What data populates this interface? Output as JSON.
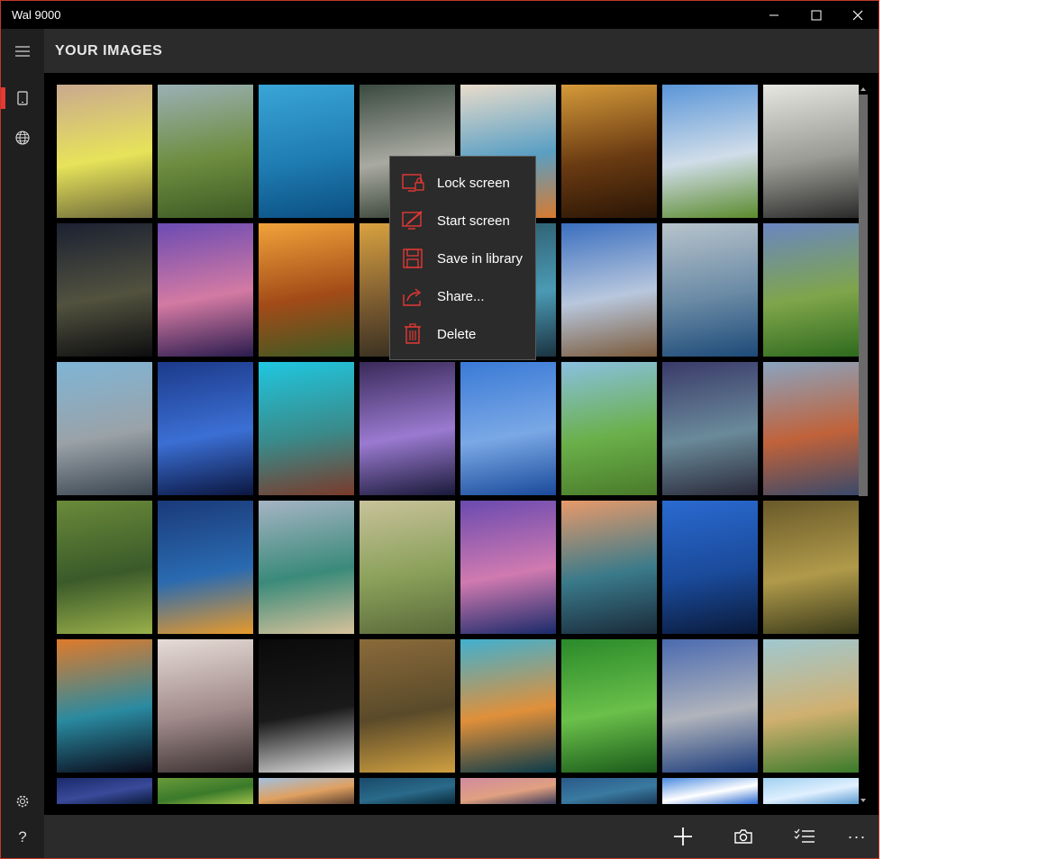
{
  "window": {
    "title": "Wal 9000",
    "minimize_icon": "minimize-icon",
    "maximize_icon": "maximize-icon",
    "close_icon": "close-icon"
  },
  "sidebar": {
    "items": [
      {
        "name": "hamburger-menu",
        "icon": "hamburger-icon"
      },
      {
        "name": "nav-device-images",
        "icon": "phone-icon",
        "active": true
      },
      {
        "name": "nav-online-images",
        "icon": "globe-icon"
      },
      {
        "name": "nav-settings",
        "icon": "gear-icon"
      },
      {
        "name": "nav-help",
        "icon": "help-icon",
        "glyph": "?"
      }
    ]
  },
  "header": {
    "title": "YOUR IMAGES"
  },
  "context_menu": {
    "items": [
      {
        "label": "Lock screen",
        "icon": "lock-screen-icon"
      },
      {
        "label": "Start screen",
        "icon": "start-screen-icon"
      },
      {
        "label": "Save in library",
        "icon": "save-icon"
      },
      {
        "label": "Share...",
        "icon": "share-icon"
      },
      {
        "label": "Delete",
        "icon": "trash-icon"
      }
    ],
    "accent": "#e53935"
  },
  "gallery": {
    "thumbnails": [
      "yellow birds",
      "green hills",
      "sea dragon",
      "white stoat",
      "kingfisher splash",
      "autumn trees",
      "mountain cabin",
      "white tiger",
      "dusk mountains",
      "purple grass",
      "sunset meadow",
      "golden field",
      "lake reflection",
      "desert road",
      "glacier ice",
      "green field",
      "whale",
      "blue wave",
      "lionfish",
      "lake pier",
      "misty blue",
      "green path",
      "mountain lake",
      "cliff sunset",
      "green snake",
      "blue fish",
      "beach waves",
      "dandelions",
      "purple sunset",
      "mountain fog",
      "blue lake",
      "lynx",
      "nebula",
      "shore birds",
      "black hole",
      "hedgehog",
      "sunset water",
      "green grass",
      "shark",
      "green meadow",
      "underwater",
      "frog",
      "cat",
      "ocean",
      "pink sky",
      "blue sea",
      "clouds",
      "sun rays"
    ]
  },
  "bottom_bar": {
    "buttons": [
      {
        "name": "add-button",
        "icon": "plus-icon"
      },
      {
        "name": "camera-button",
        "icon": "camera-icon"
      },
      {
        "name": "select-button",
        "icon": "checklist-icon"
      },
      {
        "name": "more-button",
        "icon": "more-icon",
        "glyph": "···"
      }
    ]
  },
  "colors": {
    "accent": "#e53935",
    "chrome": "#2b2b2b",
    "sidebar": "#1f1f1f"
  }
}
